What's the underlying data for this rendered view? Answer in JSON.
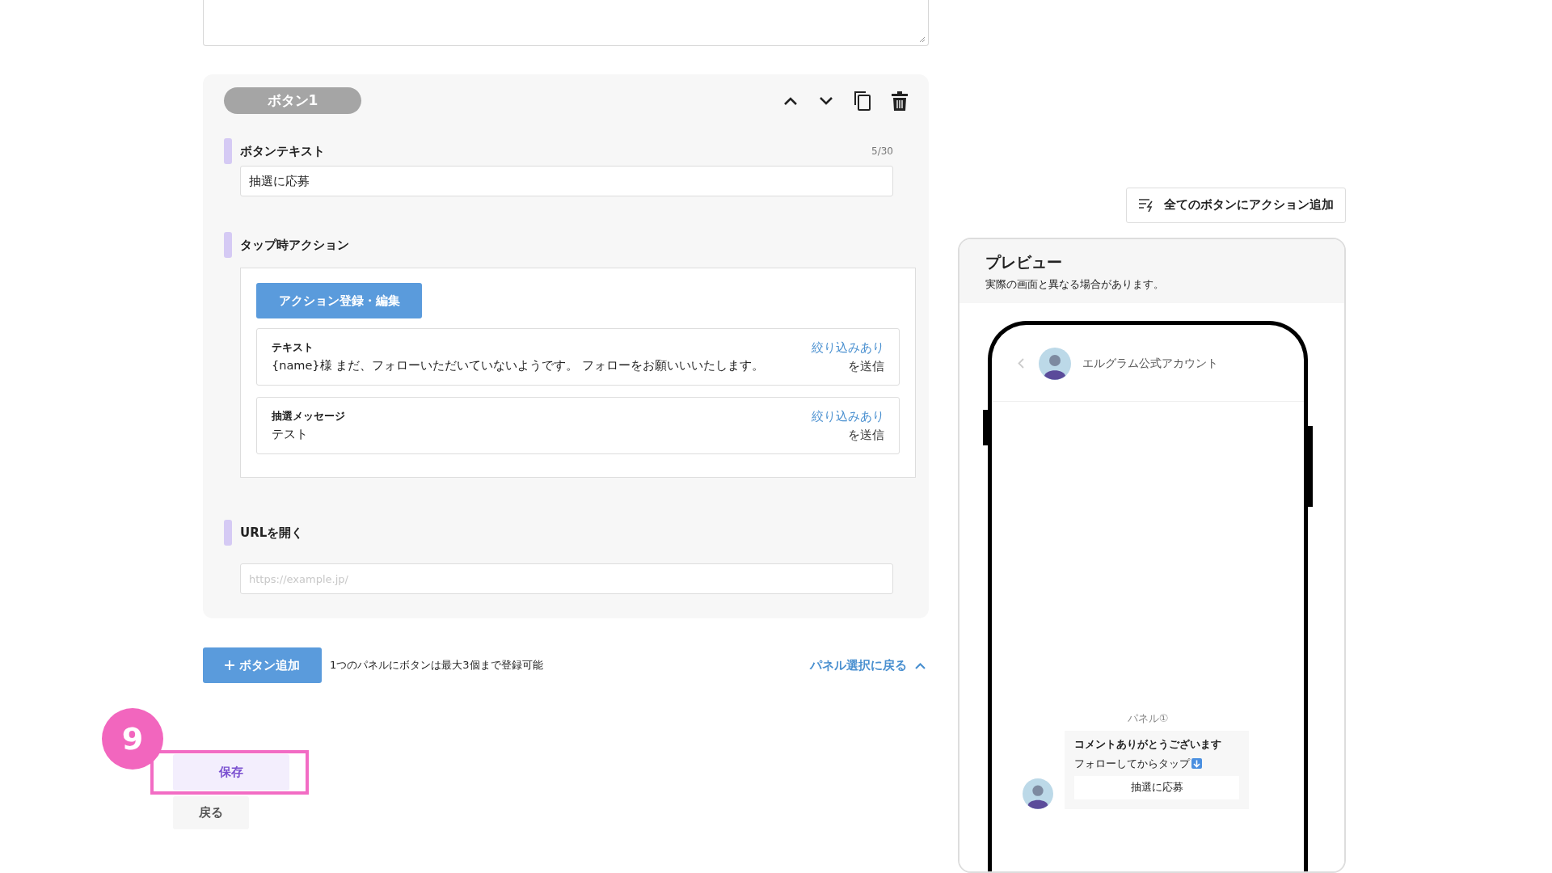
{
  "button_card": {
    "badge": "ボタン1",
    "button_text": {
      "label": "ボタンテキスト",
      "counter": "5/30",
      "value": "抽選に応募"
    },
    "tap_action": {
      "label": "タップ時アクション",
      "edit_button": "アクション登録・編集",
      "actions": [
        {
          "type": "テキスト",
          "content": "{name}様 まだ、フォローいただいていないようです。 フォローをお願いいいたします。",
          "filter": "絞り込みあり",
          "send": "を送信"
        },
        {
          "type": "抽選メッセージ",
          "content": "テスト",
          "filter": "絞り込みあり",
          "send": "を送信"
        }
      ]
    },
    "open_url": {
      "label": "URLを開く",
      "placeholder": "https://example.jp/"
    }
  },
  "add_button": "ボタン追加",
  "limit_note": "1つのパネルにボタンは最大3個まで登録可能",
  "back_to_panels": "パネル選択に戻る",
  "step_badge": "9",
  "save_button": "保存",
  "back_button": "戻る",
  "bulk_action_button": "全てのボタンにアクション追加",
  "preview": {
    "title": "プレビュー",
    "note": "実際の画面と異なる場合があります。",
    "account_name": "エルグラム公式アカウント",
    "panel_label": "パネル①",
    "message_title": "コメントありがとうございます",
    "message_body": "フォローしてからタップ",
    "message_button": "抽選に応募"
  }
}
